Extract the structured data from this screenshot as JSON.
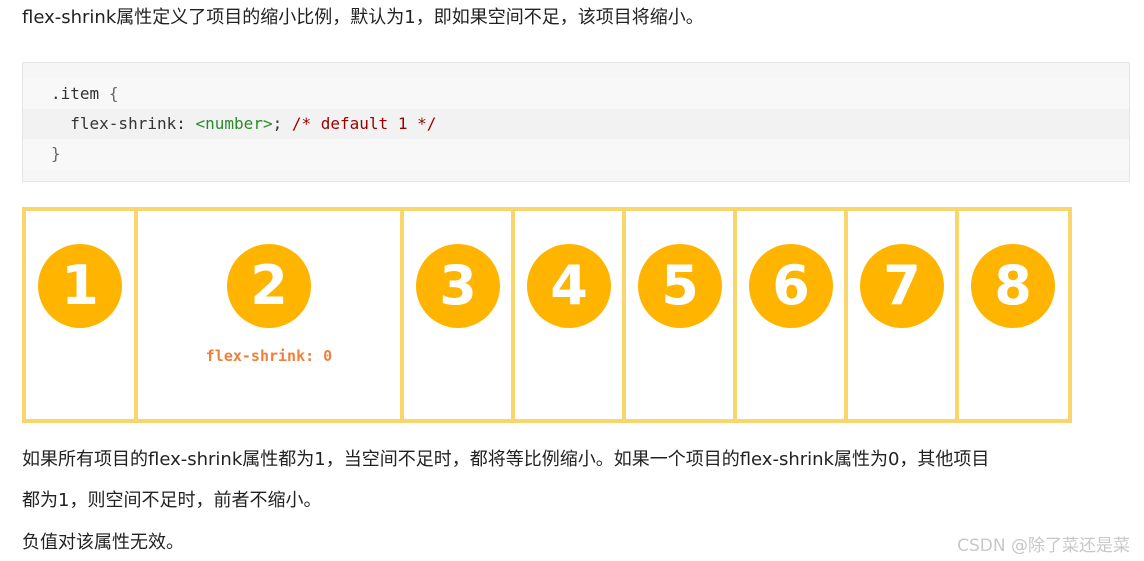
{
  "intro": "flex-shrink属性定义了项目的缩小比例，默认为1，即如果空间不足，该项目将缩小。",
  "code": {
    "selector": ".item",
    "open_brace": "{",
    "property": "flex-shrink",
    "colon": ":",
    "value": "<number>",
    "semicolon": ";",
    "comment": "/* default 1 */",
    "close_brace": "}"
  },
  "figure": {
    "items": [
      {
        "number": "1"
      },
      {
        "number": "2",
        "label": "flex-shrink: 0"
      },
      {
        "number": "3"
      },
      {
        "number": "4"
      },
      {
        "number": "5"
      },
      {
        "number": "6"
      },
      {
        "number": "7"
      },
      {
        "number": "8"
      }
    ],
    "colors": {
      "container": "#f9d66b",
      "circle": "#ffb400",
      "label": "#f07f3c"
    }
  },
  "para1_line1": "如果所有项目的flex-shrink属性都为1，当空间不足时，都将等比例缩小。如果一个项目的flex-shrink属性为0，其他项目",
  "para1_line2": "都为1，则空间不足时，前者不缩小。",
  "para2": "负值对该属性无效。",
  "watermark": "CSDN @除了菜还是菜"
}
